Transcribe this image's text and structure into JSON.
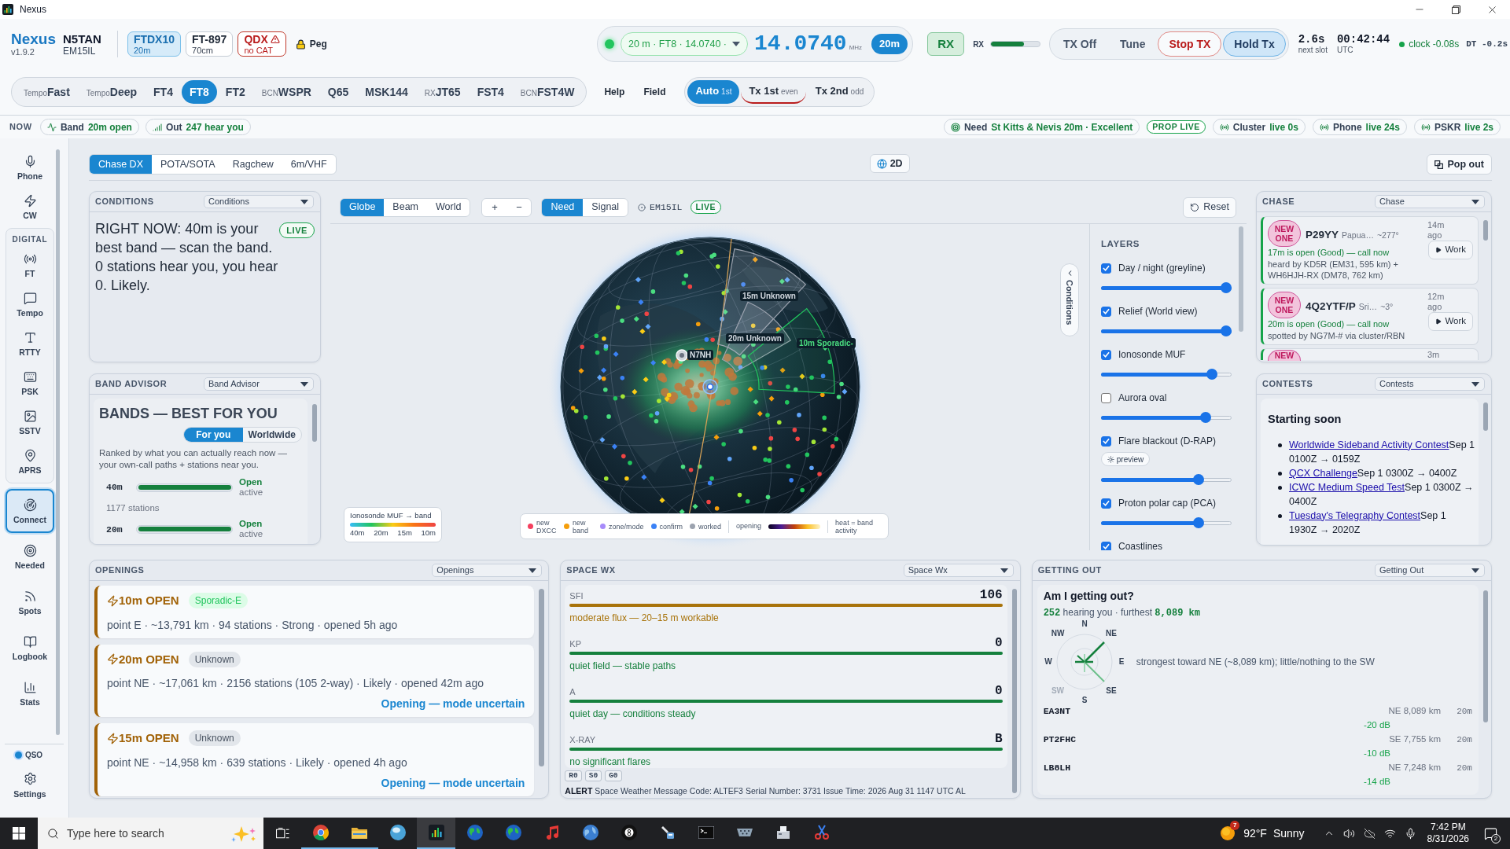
{
  "window": {
    "title": "Nexus"
  },
  "header": {
    "app": {
      "name": "Nexus",
      "version": "v1.9.2"
    },
    "station": {
      "call": "N5TAN",
      "grid": "EM15IL"
    },
    "radios": [
      {
        "name": "FTDX10",
        "detail": "20m",
        "selected": true,
        "fault": false
      },
      {
        "name": "FT-897",
        "detail": "70cm",
        "selected": false,
        "fault": false
      },
      {
        "name": "QDX",
        "detail": "no CAT",
        "selected": false,
        "fault": true
      }
    ],
    "peg": "Peg",
    "tuning": {
      "connected": true,
      "preset": "20 m · FT8 · 14.0740 ·",
      "frequency": "14.0740",
      "unit": "MHz",
      "band": "20m"
    },
    "rx": {
      "label": "RX",
      "on": true
    },
    "rx_meter": {
      "label": "RX",
      "level": 0.67
    },
    "tx": [
      {
        "label": "TX Off",
        "kind": "plain",
        "on": false
      },
      {
        "label": "Tune",
        "kind": "plain",
        "on": false
      },
      {
        "label": "Stop TX",
        "kind": "stop",
        "on": false
      },
      {
        "label": "Hold Tx",
        "kind": "plain",
        "on": true
      }
    ],
    "timing": [
      {
        "value": "2.6s",
        "label": "next slot"
      },
      {
        "value": "00:42:44",
        "label": "UTC"
      }
    ],
    "clock": {
      "label": "clock -0.08s",
      "ok": true
    },
    "dt": "DT -0.2s"
  },
  "modes": [
    {
      "prefix": "Tempo",
      "label": "Fast",
      "selected": false
    },
    {
      "prefix": "Tempo",
      "label": "Deep",
      "selected": false
    },
    {
      "label": "FT4",
      "selected": false
    },
    {
      "label": "FT8",
      "selected": true
    },
    {
      "label": "FT2",
      "selected": false
    },
    {
      "prefix": "BCN",
      "label": "WSPR",
      "selected": false
    },
    {
      "label": "Q65",
      "selected": false
    },
    {
      "label": "MSK144",
      "selected": false
    },
    {
      "prefix": "RX",
      "label": "JT65",
      "selected": false
    },
    {
      "label": "FST4",
      "selected": false
    },
    {
      "prefix": "BCN",
      "label": "FST4W",
      "selected": false
    }
  ],
  "links": [
    "Help",
    "Field"
  ],
  "slots": [
    {
      "label": "Auto",
      "sub": "1st",
      "selected": true,
      "armed": false
    },
    {
      "label": "Tx 1st",
      "sub": "even",
      "selected": false,
      "armed": true
    },
    {
      "label": "Tx 2nd",
      "sub": "odd",
      "selected": false,
      "armed": false
    }
  ],
  "now_bar": {
    "label": "NOW",
    "left": [
      {
        "kind": "band",
        "label": "Band",
        "value": "20m open"
      },
      {
        "kind": "out",
        "label": "Out",
        "value": "247 hear you"
      }
    ],
    "right": [
      {
        "kind": "need",
        "label": "Need",
        "value": "St Kitts & Nevis 20m · Excellent"
      },
      {
        "kind": "prop",
        "label": "PROP LIVE"
      },
      {
        "kind": "feed",
        "label": "Cluster",
        "value": "live 0s"
      },
      {
        "kind": "feed",
        "label": "Phone",
        "value": "live 24s"
      },
      {
        "kind": "feed",
        "label": "PSKR",
        "value": "live 2s"
      }
    ]
  },
  "sidebar": {
    "sections": [
      {
        "items": [
          {
            "label": "Phone",
            "selected": false
          },
          {
            "label": "CW",
            "selected": false
          }
        ]
      },
      {
        "label": "DIGITAL",
        "items": [
          {
            "label": "FT",
            "selected": false
          },
          {
            "label": "Tempo",
            "selected": false
          },
          {
            "label": "RTTY",
            "selected": false
          },
          {
            "label": "PSK",
            "selected": false
          },
          {
            "label": "SSTV",
            "selected": false
          },
          {
            "label": "APRS",
            "selected": false
          }
        ]
      },
      {
        "items": [
          {
            "label": "Connect",
            "selected": true
          },
          {
            "label": "Needed",
            "selected": false
          },
          {
            "label": "Spots",
            "selected": false
          },
          {
            "label": "Logbook",
            "selected": false
          },
          {
            "label": "Stats",
            "selected": false
          }
        ]
      }
    ],
    "qso": {
      "label": "QSO",
      "on": true
    },
    "settings": "Settings"
  },
  "workspace_tabs": [
    {
      "label": "Chase DX",
      "selected": true
    },
    {
      "label": "POTA/SOTA",
      "selected": false
    },
    {
      "label": "Ragchew",
      "selected": false
    },
    {
      "label": "6m/VHF",
      "selected": false
    }
  ],
  "view_toggle": "2D",
  "pop_out": "Pop out",
  "conditions": {
    "title": "CONDITIONS",
    "select": "Conditions",
    "live": "LIVE",
    "text": "RIGHT NOW: 40m is your best band — scan the band. 0 stations hear you, you hear 0. Likely."
  },
  "band_advisor": {
    "title": "BAND ADVISOR",
    "select": "Band Advisor",
    "heading": "BANDS — BEST FOR YOU",
    "scope": [
      {
        "label": "For you",
        "selected": true
      },
      {
        "label": "Worldwide",
        "selected": false
      }
    ],
    "note": "Ranked by what you can actually reach now — your own-call paths + stations near you.",
    "bands": [
      {
        "band": "40m",
        "level": 1,
        "status": "Open",
        "activity": "active",
        "stations": "1177 stations"
      },
      {
        "band": "20m",
        "level": 1,
        "status": "Open",
        "activity": "active"
      }
    ]
  },
  "map": {
    "views": [
      {
        "label": "Globe",
        "selected": true
      },
      {
        "label": "Beam",
        "selected": false
      },
      {
        "label": "World",
        "selected": false
      }
    ],
    "zoom": [
      "+",
      "−"
    ],
    "filters": [
      {
        "label": "Need",
        "selected": true
      },
      {
        "label": "Signal",
        "selected": false
      }
    ],
    "locator": "EM15IL",
    "live": "LIVE",
    "reset": "Reset",
    "sectors": [
      {
        "label": "15m Unknown",
        "kind": "unknown"
      },
      {
        "label": "20m Unknown",
        "kind": "unknown"
      },
      {
        "label": "10m Sporadic-",
        "kind": "sporadic"
      }
    ],
    "station": "N7NH",
    "side_tab": "Conditions",
    "muf_legend": {
      "title": "Ionosonde MUF → band",
      "ticks": [
        "40m",
        "20m",
        "15m",
        "10m"
      ]
    },
    "legend": [
      {
        "label": "new DXCC",
        "color": "#f43f5e"
      },
      {
        "label": "new band",
        "color": "#f59e0b"
      },
      {
        "label": "zone/mode",
        "color": "#a78bfa"
      },
      {
        "label": "confirm",
        "color": "#3b82f6"
      },
      {
        "label": "worked",
        "color": "#9ca3af"
      }
    ],
    "heat_legend": {
      "label": "opening",
      "note": "heat = band activity"
    }
  },
  "layers": {
    "title": "LAYERS",
    "items": [
      {
        "label": "Day / night (greyline)",
        "checked": true,
        "level": 1
      },
      {
        "label": "Relief (World view)",
        "checked": true,
        "level": 1
      },
      {
        "label": "Ionosonde MUF",
        "checked": true,
        "level": 0.88
      },
      {
        "label": "Aurora oval",
        "checked": false,
        "level": 0.83
      },
      {
        "label": "Flare blackout (D-RAP)",
        "checked": true,
        "preview": "preview",
        "level": 0.77
      },
      {
        "label": "Proton polar cap (PCA)",
        "checked": true,
        "level": 0.77
      },
      {
        "label": "Coastlines",
        "checked": true
      }
    ]
  },
  "chase": {
    "title": "CHASE",
    "select": "Chase",
    "items": [
      {
        "kind": "full",
        "badge": "NEW ONE",
        "call": "P29YY",
        "place": "Papua…",
        "bearing": "~277°",
        "age": "14m ago",
        "status": "17m is open (Good) — call now",
        "detail": "heard by KD5R (EM31, 595 km) + WH6HJH-RX (DM78, 762 km)",
        "action": "Work"
      },
      {
        "kind": "full",
        "badge": "NEW ONE",
        "call": "4Q2YTF/P",
        "place": "Sri…",
        "bearing": "~3°",
        "age": "12m ago",
        "status": "20m is open (Good) — call now",
        "detail": "spotted by NG7M-# via cluster/RBN",
        "action": "Work"
      },
      {
        "kind": "peek",
        "badge": "NEW",
        "age": "3m"
      }
    ]
  },
  "contests": {
    "title": "CONTESTS",
    "select": "Contests",
    "heading": "Starting soon",
    "items": [
      {
        "name": "Worldwide Sideband Activity Contest",
        "time": "Sep 1 0100Z → 0159Z"
      },
      {
        "name": "QCX Challenge",
        "time": "Sep 1 0300Z → 0400Z"
      },
      {
        "name": "ICWC Medium Speed Test",
        "time": "Sep 1 0300Z → 0400Z"
      },
      {
        "name": "Tuesday's Telegraphy Contest",
        "time": "Sep 1 1930Z → 2020Z"
      }
    ]
  },
  "openings": {
    "title": "OPENINGS",
    "select": "Openings",
    "items": [
      {
        "title": "10m OPEN",
        "mode": "Sporadic-E",
        "kind": "sporadic",
        "detail": "point E · ~13,791 km · 94 stations · Strong · opened 5h ago"
      },
      {
        "title": "20m OPEN",
        "mode": "Unknown",
        "kind": "unknown",
        "detail": "point NE · ~17,061 km · 2156 stations (105 2-way) · Likely · opened 42m ago",
        "note": "Opening — mode uncertain"
      },
      {
        "title": "15m OPEN",
        "mode": "Unknown",
        "kind": "unknown",
        "detail": "point NE · ~14,958 km · 639 stations · Likely · opened 4h ago",
        "note": "Opening — mode uncertain"
      }
    ]
  },
  "space_wx": {
    "title": "SPACE WX",
    "select": "Space Wx",
    "items": [
      {
        "label": "SFI",
        "value": "106",
        "note": "moderate flux — 20–15 m workable",
        "color": "#a8730a"
      },
      {
        "label": "KP",
        "value": "0",
        "note": "quiet field — stable paths",
        "color": "#15803d"
      },
      {
        "label": "A",
        "value": "0",
        "note": "quiet day — conditions steady",
        "color": "#15803d"
      },
      {
        "label": "X-RAY",
        "value": "B",
        "note": "no significant flares",
        "color": "#15803d"
      }
    ],
    "scales": [
      "R0",
      "S0",
      "G0"
    ],
    "alert": {
      "label": "ALERT",
      "text": "Space Weather Message Code: ALTEF3 Serial Number: 3731 Issue Time: 2026 Aug 31 1147 UTC AL"
    }
  },
  "getting_out": {
    "title": "GETTING OUT",
    "select": "Getting Out",
    "heading": "Am I getting out?",
    "reach": {
      "count": "252",
      "text": "hearing you · furthest",
      "distance": "8,089 km"
    },
    "compass": [
      {
        "label": "N",
        "dim": false
      },
      {
        "label": "NE",
        "dim": false
      },
      {
        "label": "E",
        "dim": false
      },
      {
        "label": "SE",
        "dim": false
      },
      {
        "label": "S",
        "dim": false
      },
      {
        "label": "SW",
        "dim": true
      },
      {
        "label": "W",
        "dim": false
      },
      {
        "label": "NW",
        "dim": false
      }
    ],
    "summary": "strongest toward NE (~8,089 km); little/nothing to the SW",
    "stations": [
      {
        "call": "EA3NT",
        "path": "NE 8,089 km",
        "band": "20m",
        "snr": "-20 dB"
      },
      {
        "call": "PT2FHC",
        "path": "SE 7,755 km",
        "band": "20m",
        "snr": "-10 dB"
      },
      {
        "call": "LB8LH",
        "path": "NE 7,248 km",
        "band": "20m",
        "snr": "-14 dB"
      }
    ]
  },
  "taskbar": {
    "placeholder": "Type here to search",
    "apps": [
      {
        "running": true,
        "selected": false
      },
      {
        "running": true,
        "selected": false
      },
      {
        "running": false,
        "selected": false
      },
      {
        "running": true,
        "selected": true
      },
      {
        "running": false,
        "selected": false
      },
      {
        "running": false,
        "selected": false
      },
      {
        "running": false,
        "selected": false
      },
      {
        "running": false,
        "selected": false
      },
      {
        "running": false,
        "selected": false
      },
      {
        "running": false,
        "selected": false
      },
      {
        "running": false,
        "selected": false
      },
      {
        "running": false,
        "selected": false
      },
      {
        "running": false,
        "selected": false
      },
      {
        "running": false,
        "selected": false
      }
    ],
    "weather": {
      "badge": "7",
      "temp": "92°F",
      "text": "Sunny"
    },
    "time": "7:42 PM",
    "date": "8/31/2026",
    "notifications": "2"
  }
}
